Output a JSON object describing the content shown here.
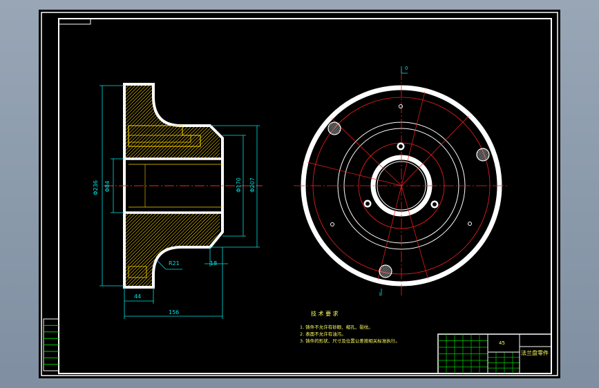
{
  "colors": {
    "background": "#000000",
    "frame": "#ffffff",
    "dimension": "#00e5e5",
    "centerline": "#ff2020",
    "hatch": "#ffd700",
    "text": "#ffff60",
    "title_block": "#00d000"
  },
  "dimensions": {
    "left_dia_outer": "Φ236",
    "left_dia_inner": "Φ84",
    "right_dia_1": "Φ170",
    "right_dia_2": "Φ207",
    "radius": "R21",
    "bottom_small": "18",
    "bottom_flange": "44",
    "overall_length": "156"
  },
  "tech_req": {
    "title": "技 术 要 求",
    "items": [
      "1. 铸件不允许有砂眼、缩孔、裂纹。",
      "2. 表面不允许有油污。",
      "3. 铸件的形状、尺寸及位置公差按相关标准执行。"
    ]
  },
  "title_block": {
    "material": "45",
    "part_name": "法兰盘零件"
  },
  "top_marker": "0",
  "bottom_marker": "1"
}
